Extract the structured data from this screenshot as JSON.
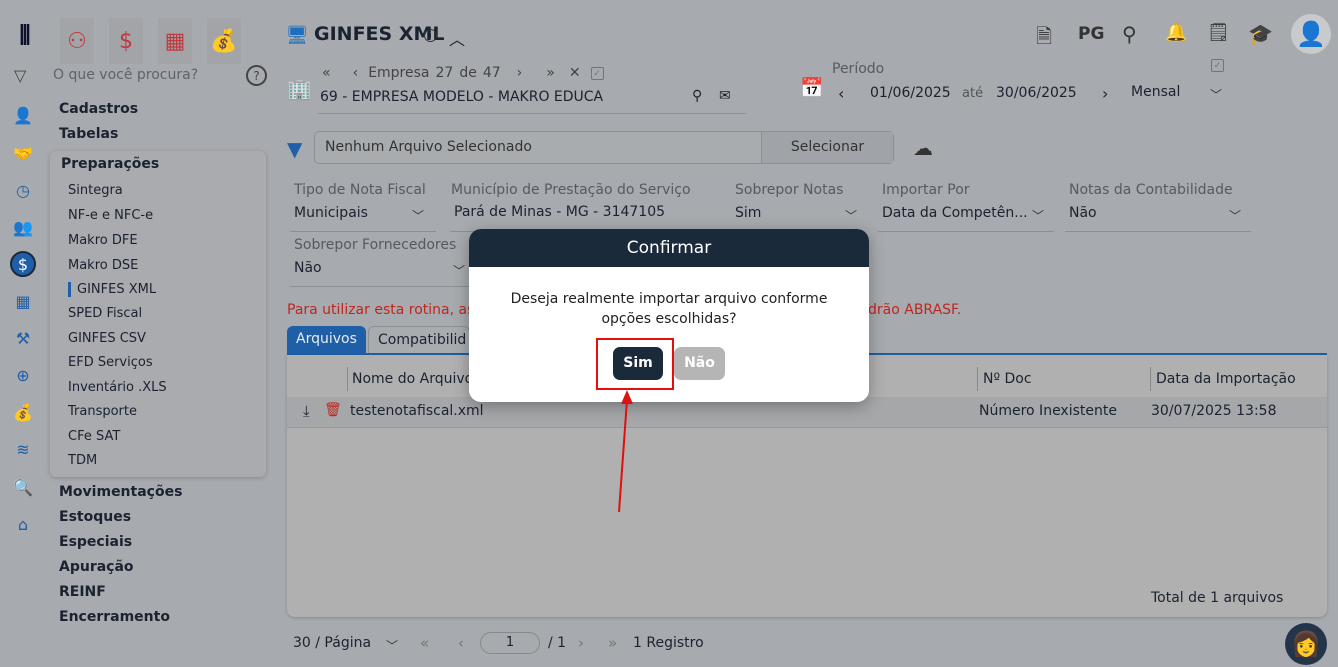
{
  "header": {
    "title": "GINFES XML",
    "pg": "PG"
  },
  "sidebar": {
    "search_placeholder": "O que você procura?",
    "top_items": [
      "Cadastros",
      "Tabelas"
    ],
    "group": "Preparações",
    "sub_items": [
      "Sintegra",
      "NF-e e NFC-e",
      "Makro DFE",
      "Makro DSE",
      "GINFES XML",
      "SPED Fiscal",
      "GINFES CSV",
      "EFD Serviços",
      "Inventário .XLS",
      "Transporte",
      "CFe SAT",
      "TDM"
    ],
    "bottom_items": [
      "Movimentações",
      "Estoques",
      "Especiais",
      "Apuração",
      "REINF",
      "Encerramento"
    ]
  },
  "empresa": {
    "label": "Empresa",
    "current": "27",
    "of": "de",
    "total": "47",
    "name": "69 - EMPRESA MODELO - MAKRO EDUCA"
  },
  "periodo": {
    "label": "Período",
    "start": "01/06/2025",
    "until": "até",
    "end": "30/06/2025",
    "mode": "Mensal"
  },
  "file": {
    "value": "Nenhum Arquivo Selecionado",
    "button": "Selecionar"
  },
  "fields": [
    {
      "label": "Tipo de Nota Fiscal",
      "value": "Municipais"
    },
    {
      "label": "Município de Prestação do Serviço",
      "value": "Pará de Minas - MG - 3147105"
    },
    {
      "label": "Sobrepor Notas",
      "value": "Sim"
    },
    {
      "label": "Importar Por",
      "value": "Data da Competên..."
    },
    {
      "label": "Notas da Contabilidade",
      "value": "Não"
    },
    {
      "label": "Sobrepor Fornecedores",
      "value": "Não"
    }
  ],
  "warning_left": "Para utilizar esta rotina, as",
  "warning_right": "drão ABRASF.",
  "tabs": [
    "Arquivos",
    "Compatibilid"
  ],
  "table": {
    "headers": [
      "Nome do Arquivo",
      "Nº Doc",
      "Data da Importação"
    ],
    "rows": [
      {
        "name": "testenotafiscal.xml",
        "doc": "Número Inexistente",
        "date": "30/07/2025 13:58"
      }
    ],
    "total": "Total de 1 arquivos"
  },
  "pager": {
    "per_page": "30 / Página",
    "page": "1",
    "of": "/ 1",
    "records": "1 Registro"
  },
  "modal": {
    "title": "Confirmar",
    "message": "Deseja realmente importar arquivo conforme opções escolhidas?",
    "yes": "Sim",
    "no": "Não"
  }
}
